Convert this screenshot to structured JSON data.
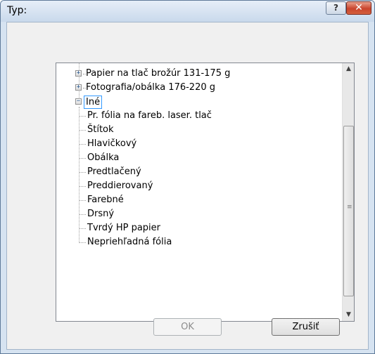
{
  "window": {
    "title": "Typ:",
    "help_label": "?",
    "close_label": "✕"
  },
  "tree": {
    "collapsed_nodes": [
      {
        "label": "Papier na tlač brožúr 131-175 g"
      },
      {
        "label": "Fotografia/obálka 176-220 g"
      }
    ],
    "expanded_node": {
      "label": "Iné",
      "selected": true
    },
    "children": [
      {
        "label": "Pr. fólia na fareb. laser. tlač"
      },
      {
        "label": "Štítok"
      },
      {
        "label": "Hlavičkový"
      },
      {
        "label": "Obálka"
      },
      {
        "label": "Predtlačený"
      },
      {
        "label": "Preddierovaný"
      },
      {
        "label": "Farebné"
      },
      {
        "label": "Drsný"
      },
      {
        "label": "Tvrdý HP papier"
      },
      {
        "label": "Nepriehľadná fólia"
      }
    ],
    "expand_glyph": "+",
    "collapse_glyph": "−"
  },
  "scrollbar": {
    "up_glyph": "▲",
    "down_glyph": "▼",
    "grip_glyph": "≡"
  },
  "buttons": {
    "ok_label": "OK",
    "cancel_label": "Zrušiť"
  }
}
